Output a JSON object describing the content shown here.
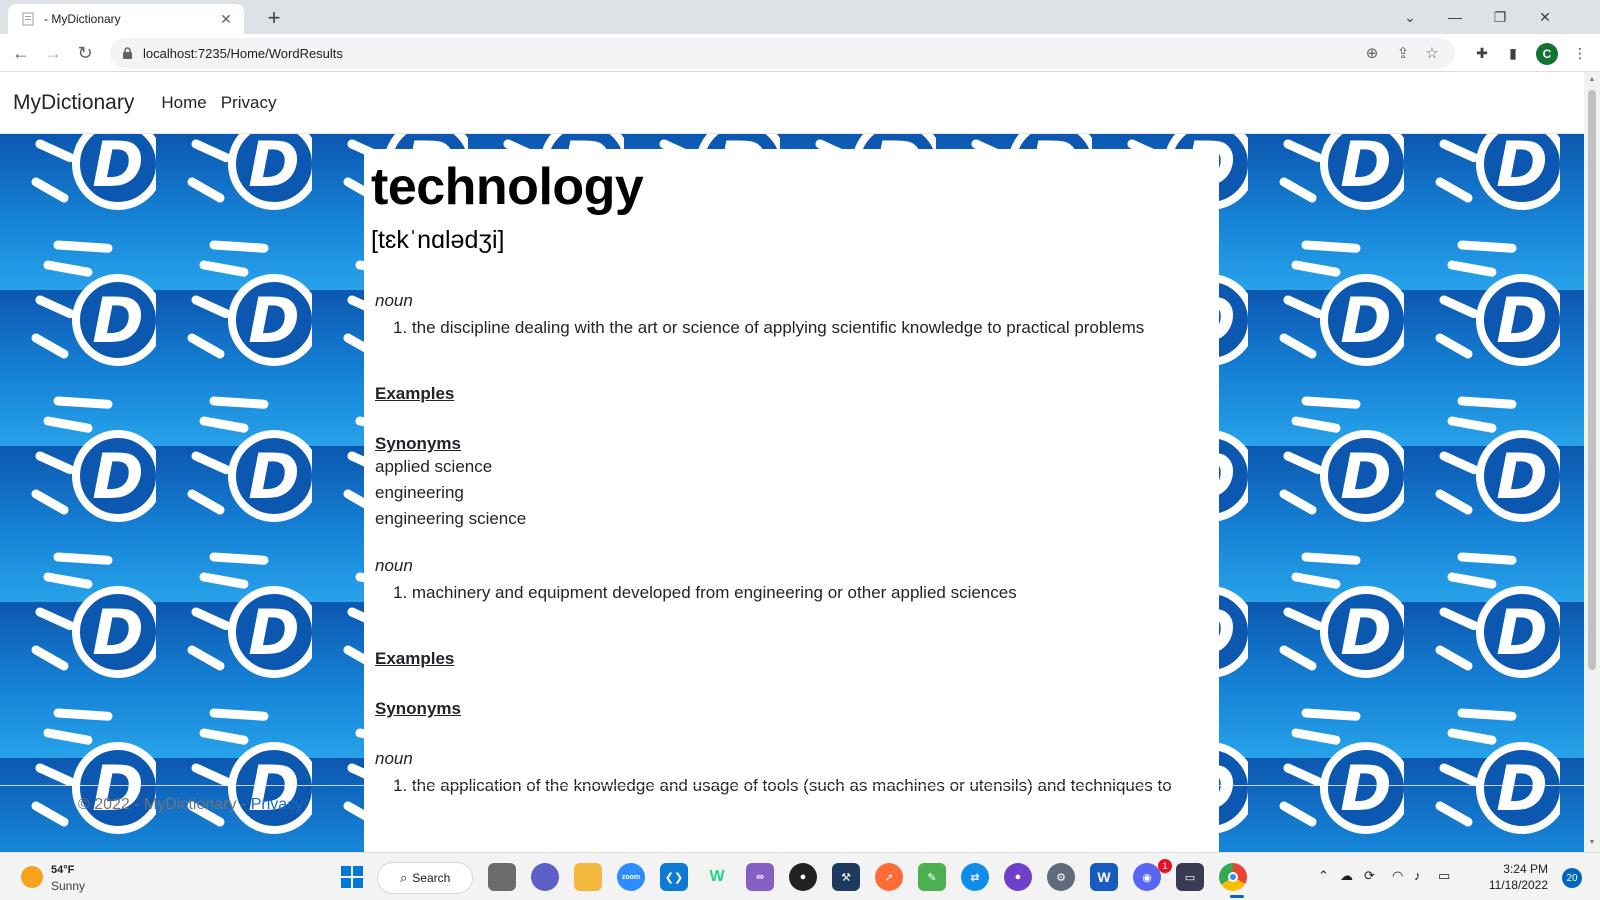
{
  "browser": {
    "tab_title": "- MyDictionary",
    "url": "localhost:7235/Home/WordResults",
    "profile_initial": "C",
    "new_tab_label": "+"
  },
  "site": {
    "brand": "MyDictionary",
    "nav": [
      "Home",
      "Privacy"
    ],
    "footer_text": "© 2022 - MyDictionary - ",
    "footer_link": "Privacy",
    "bg_logo_letter": "D"
  },
  "entry": {
    "word": "technology",
    "phonetic": "[tɛkˈnɑlədʒi]",
    "senses": [
      {
        "pos": "noun",
        "definition": "1. the discipline dealing with the art or science of applying scientific knowledge to practical problems",
        "examples_label": "Examples",
        "synonyms_label": "Synonyms",
        "synonyms": [
          "applied science",
          "engineering",
          "engineering science"
        ]
      },
      {
        "pos": "noun",
        "definition": "1. machinery and equipment developed from engineering or other applied sciences",
        "examples_label": "Examples",
        "synonyms_label": "Synonyms"
      },
      {
        "pos": "noun",
        "definition": "1. the application of the knowledge and usage of tools (such as machines or utensils) and techniques to"
      }
    ]
  },
  "taskbar": {
    "weather_temp": "54°F",
    "weather_desc": "Sunny",
    "search_label": "Search",
    "time": "3:24 PM",
    "date": "11/18/2022",
    "notifications": "20",
    "discord_badge": "1",
    "zoom_label": "zoom",
    "word_label": "W",
    "webstorm_label": "W"
  },
  "colors": {
    "bg_dark": "#0c57b0",
    "bg_light": "#27a2ea",
    "link": "#1b6ec2"
  }
}
